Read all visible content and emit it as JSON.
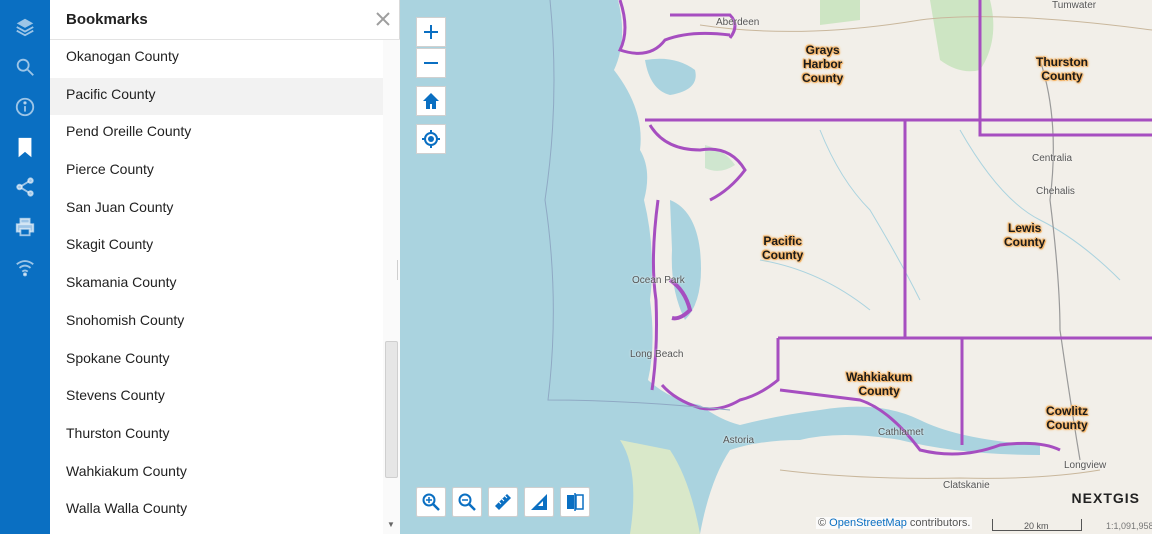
{
  "rail": {
    "items": [
      {
        "name": "layers-icon"
      },
      {
        "name": "search-icon"
      },
      {
        "name": "info-icon"
      },
      {
        "name": "bookmark-icon",
        "active": true
      },
      {
        "name": "share-icon"
      },
      {
        "name": "print-icon"
      },
      {
        "name": "wifi-icon"
      }
    ]
  },
  "panel": {
    "title": "Bookmarks",
    "items": [
      "Okanogan County",
      "Pacific County",
      "Pend Oreille County",
      "Pierce County",
      "San Juan County",
      "Skagit County",
      "Skamania County",
      "Snohomish County",
      "Spokane County",
      "Stevens County",
      "Thurston County",
      "Wahkiakum County",
      "Walla Walla County"
    ],
    "hovered_index": 1
  },
  "map": {
    "county_labels": {
      "grays_harbor": "Grays\nHarbor\nCounty",
      "thurston": "Thurston\nCounty",
      "pacific": "Pacific\nCounty",
      "lewis": "Lewis\nCounty",
      "wahkiakum": "Wahkiakum\nCounty",
      "cowlitz": "Cowlitz\nCounty"
    },
    "places": {
      "aberdeen": "Aberdeen",
      "centralia": "Centralia",
      "chehalis": "Chehalis",
      "ocean_park": "Ocean Park",
      "long_beach": "Long Beach",
      "astoria": "Astoria",
      "cathlamet": "Cathlamet",
      "clatskanie": "Clatskanie",
      "longview": "Longview",
      "tumwater": "Tumwater"
    },
    "attribution_prefix": "©",
    "attribution_link": "OpenStreetMap",
    "attribution_suffix": "contributors.",
    "scale_text": "20 km",
    "scale_value": "1:1,091,958",
    "logo": "NEXTGIS",
    "colors": {
      "water": "#aad3df",
      "land": "#f2efe9",
      "boundary": "#a64ec0",
      "label_halo": "#f5b66a",
      "accent": "#0a6fc2"
    }
  }
}
